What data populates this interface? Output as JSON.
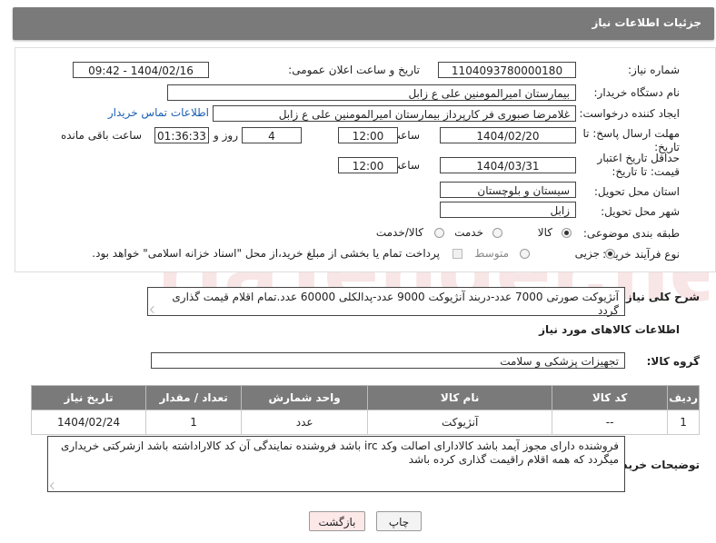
{
  "header": {
    "title": "جزئیات اطلاعات نیاز"
  },
  "form": {
    "need_number_label": "شماره نیاز:",
    "need_number": "1104093780000180",
    "announce_label": "تاریخ و ساعت اعلان عمومی:",
    "announce_value": "1404/02/16 - 09:42",
    "buyer_org_label": "نام دستگاه خریدار:",
    "buyer_org": "بیمارستان امیرالمومنین علی  ع  زابل",
    "creator_label": "ایجاد کننده درخواست:",
    "creator": "غلامرضا صبوری فر کارپرداز بیمارستان امیرالمومنین علی  ع  زابل",
    "contact_link": "اطلاعات تماس خریدار",
    "deadline_label": "مهلت ارسال پاسخ: تا تاریخ:",
    "deadline_date": "1404/02/20",
    "time_label": "ساعت",
    "deadline_time": "12:00",
    "days_value": "4",
    "days_label": "روز و",
    "remaining_value": "01:36:33",
    "remaining_label": "ساعت باقی مانده",
    "validity_label": "حداقل تاریخ اعتبار قیمت: تا تاریخ:",
    "validity_date": "1404/03/31",
    "validity_time": "12:00",
    "province_label": "استان محل تحویل:",
    "province": "سیستان و بلوچستان",
    "city_label": "شهر محل تحویل:",
    "city": "زابل",
    "category_label": "طبقه بندی موضوعی:",
    "category_options": [
      "کالا",
      "خدمت",
      "کالا/خدمت"
    ],
    "purchase_label": "نوع فرآیند خرید :",
    "purchase_options": [
      "جزیی",
      "متوسط"
    ],
    "payment_note": "پرداخت تمام یا بخشی از مبلغ خرید،از محل \"اسناد خزانه اسلامی\" خواهد بود."
  },
  "summary": {
    "label": "شرح کلی نیاز:",
    "text": "آنژیوکت صورتی 7000 عدد-دربند آنژیوکت 9000 عدد-پدالکلی 60000 عدد.تمام اقلام قیمت گذاری گردد"
  },
  "goods": {
    "section_title": "اطلاعات کالاهای مورد نیاز",
    "group_label": "گروه کالا:",
    "group_value": "تجهیزات پزشکی و سلامت",
    "columns": [
      "ردیف",
      "کد کالا",
      "نام کالا",
      "واحد شمارش",
      "تعداد / مقدار",
      "تاریخ نیاز"
    ],
    "rows": [
      [
        "1",
        "--",
        "آنژیوکت",
        "عدد",
        "1",
        "1404/02/24"
      ]
    ]
  },
  "buyer_notes": {
    "label": "توضیحات خریدار:",
    "text": "فروشنده دارای مجوز آیمد باشد کالادارای اصالت وکد  irc باشد فروشنده نمایندگی آن کد کالاراداشته باشد ازشرکتی خریداری میگردد که همه اقلام راقیمت گذاری کرده باشد"
  },
  "buttons": {
    "print": "چاپ",
    "back": "بازگشت"
  },
  "colors": {
    "header_bg": "#7a7a7a",
    "link": "#1a5fb4",
    "back_button_bg": "#fde8e8"
  }
}
